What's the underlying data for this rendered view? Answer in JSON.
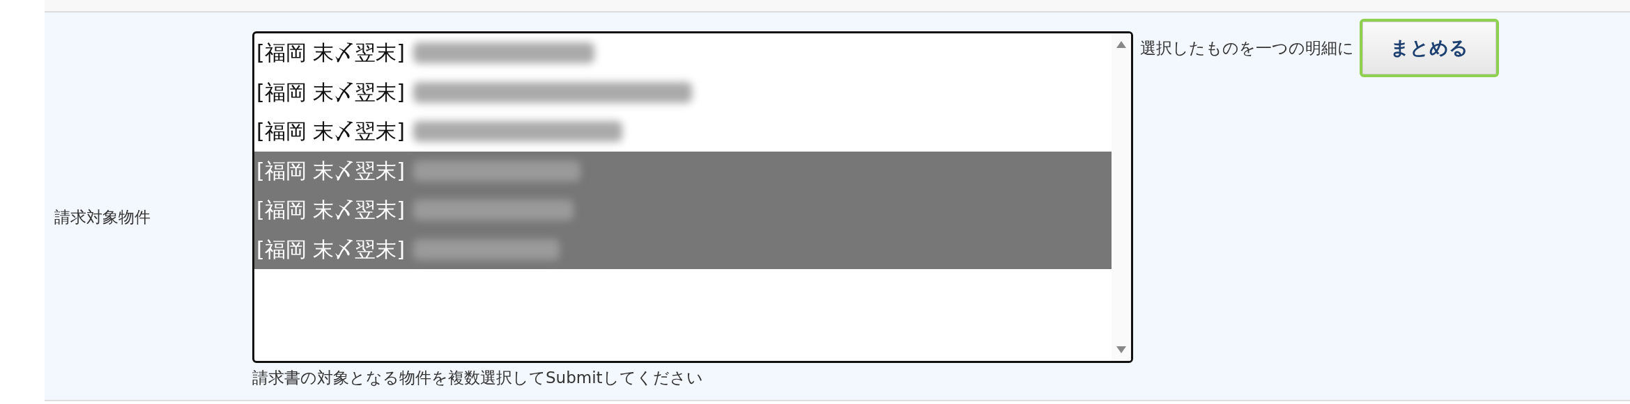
{
  "field": {
    "label": "請求対象物件",
    "options": [
      {
        "label": "[福岡 末〆翌末]",
        "selected": false
      },
      {
        "label": "[福岡 末〆翌末]",
        "selected": false
      },
      {
        "label": "[福岡 末〆翌末]",
        "selected": false
      },
      {
        "label": "[福岡 末〆翌末]",
        "selected": true
      },
      {
        "label": "[福岡 末〆翌末]",
        "selected": true
      },
      {
        "label": "[福岡 末〆翌末]",
        "selected": true
      }
    ],
    "hint": "請求書の対象となる物件を複数選択してSubmitしてください"
  },
  "merge": {
    "caption": "選択したものを一つの明細に",
    "button": "まとめる"
  }
}
